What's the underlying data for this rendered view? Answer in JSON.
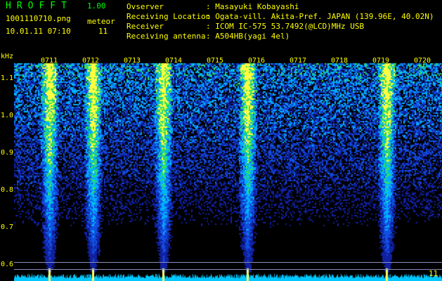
{
  "header": {
    "logo": "HROFFT",
    "version": "1.00",
    "file": "1001110710.png",
    "date": "10.01.11 07:10",
    "meteor_label": "meteor",
    "meteor_count": "11",
    "fields": [
      {
        "label": "Ovserver",
        "value": ": Masayuki Kobayashi"
      },
      {
        "label": "Receiving Location",
        "value": ": Ogata-vill. Akita-Pref. JAPAN (139.96E, 40.02N)"
      },
      {
        "label": "Receiver",
        "value": ": ICOM IC-575 53.7492(@LCD)MHz USB"
      },
      {
        "label": "Receiving antenna",
        "value": ": A504HB(yagi 4el)"
      }
    ]
  },
  "spectrogram": {
    "y_unit": "kHz",
    "y_ticks": [
      "1.1",
      "1.0",
      "0.9",
      "0.8",
      "0.7",
      "0.6"
    ],
    "y_ticks_values": [
      1.1,
      1.0,
      0.9,
      0.8,
      0.7,
      0.6
    ],
    "ylim": [
      0.58,
      1.16
    ],
    "time_labels": [
      "0711",
      "0712",
      "0713",
      "0714",
      "0715",
      "0716",
      "0717",
      "0718",
      "0719",
      "0720"
    ],
    "bottom_right_mark": "11",
    "colors": {
      "background": "#000000",
      "text": "#ffff00",
      "logo": "#00ff00",
      "noise_low": "#0000a0",
      "noise_high": "#00c8ff",
      "signal": "#ffff00"
    }
  }
}
